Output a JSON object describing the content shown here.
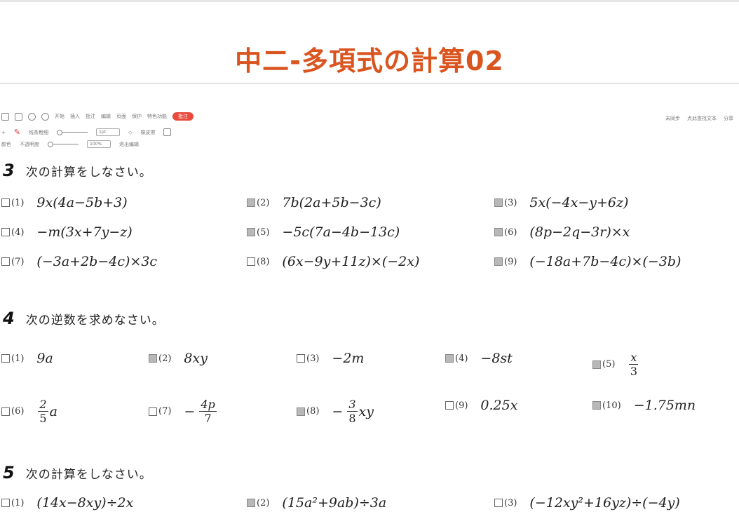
{
  "title": "中二-多項式の計算02",
  "toolbar": {
    "row1": [
      "开始",
      "插入",
      "批注",
      "编辑",
      "页面",
      "保护",
      "特色功能"
    ],
    "active_tab": "批注",
    "right": [
      "未同步",
      "点此查找文本",
      "分享"
    ],
    "row2_labels": [
      "线条粗细",
      "1pt",
      "橡皮擦"
    ],
    "row3_labels": [
      "颜色",
      "不透明度",
      "100%",
      "退出编辑"
    ]
  },
  "section3": {
    "number": "3",
    "instruction": "次の計算をしなさい。",
    "problems": [
      {
        "label": "(1)",
        "expr": "9x(4a−5b+3)",
        "checked": false
      },
      {
        "label": "(2)",
        "expr": "7b(2a+5b−3c)",
        "checked": true
      },
      {
        "label": "(3)",
        "expr": "5x(−4x−y+6z)",
        "checked": true
      },
      {
        "label": "(4)",
        "expr": "−m(3x+7y−z)",
        "checked": false
      },
      {
        "label": "(5)",
        "expr": "−5c(7a−4b−13c)",
        "checked": true
      },
      {
        "label": "(6)",
        "expr": "(8p−2q−3r)×x",
        "checked": true
      },
      {
        "label": "(7)",
        "expr": "(−3a+2b−4c)×3c",
        "checked": false
      },
      {
        "label": "(8)",
        "expr": "(6x−9y+11z)×(−2x)",
        "checked": false
      },
      {
        "label": "(9)",
        "expr": "(−18a+7b−4c)×(−3b)",
        "checked": true
      }
    ]
  },
  "section4": {
    "number": "4",
    "instruction": "次の逆数を求めなさい。",
    "problems": [
      {
        "label": "(1)",
        "expr": "9a",
        "checked": false
      },
      {
        "label": "(2)",
        "expr": "8xy",
        "checked": true
      },
      {
        "label": "(3)",
        "expr": "−2m",
        "checked": false
      },
      {
        "label": "(4)",
        "expr": "−8st",
        "checked": true
      },
      {
        "label": "(5)",
        "num": "x",
        "den": "3",
        "checked": true
      },
      {
        "label": "(6)",
        "num": "2",
        "den": "5",
        "after": "a",
        "checked": false
      },
      {
        "label": "(7)",
        "pre": "−",
        "num": "4p",
        "den": "7",
        "checked": false
      },
      {
        "label": "(8)",
        "pre": "−",
        "num": "3",
        "den": "8",
        "after": "xy",
        "checked": true
      },
      {
        "label": "(9)",
        "expr": "0.25x",
        "checked": false
      },
      {
        "label": "(10)",
        "expr": "−1.75mn",
        "checked": true
      }
    ]
  },
  "section5": {
    "number": "5",
    "instruction": "次の計算をしなさい。",
    "problems": [
      {
        "label": "(1)",
        "expr": "(14x−8xy)÷2x",
        "checked": false
      },
      {
        "label": "(2)",
        "expr": "(15a²+9ab)÷3a",
        "checked": true
      },
      {
        "label": "(3)",
        "expr": "(−12xy²+16yz)÷(−4y)",
        "checked": false
      }
    ]
  }
}
